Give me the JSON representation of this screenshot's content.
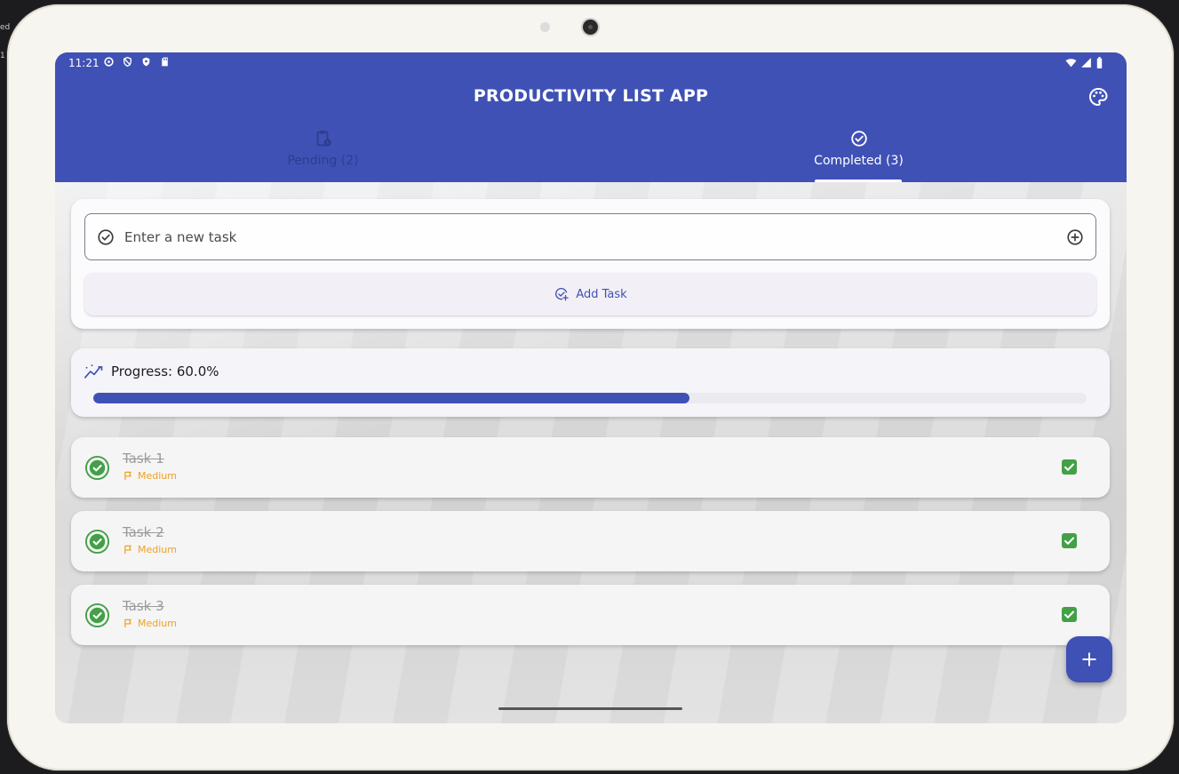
{
  "edge": {
    "top_label": "ed",
    "second_label": "1"
  },
  "status_bar": {
    "time": "11:21"
  },
  "app": {
    "title": "PRODUCTIVITY LIST APP"
  },
  "tabs": [
    {
      "label": "Pending (2)",
      "icon": "clipboard-clock-icon",
      "selected": false
    },
    {
      "label": "Completed (3)",
      "icon": "check-circle-icon",
      "selected": true
    }
  ],
  "task_input": {
    "placeholder": "Enter a new task",
    "value": ""
  },
  "add_task": {
    "label": "Add Task"
  },
  "progress": {
    "label": "Progress: 60.0%",
    "value": 0.6
  },
  "tasks": [
    {
      "title": "Task 1",
      "priority": "Medium",
      "completed": true
    },
    {
      "title": "Task 2",
      "priority": "Medium",
      "completed": true
    },
    {
      "title": "Task 3",
      "priority": "Medium",
      "completed": true
    }
  ],
  "colors": {
    "primary": "#3f51b5",
    "success": "#43a047",
    "priority_medium": "#f0a020"
  }
}
